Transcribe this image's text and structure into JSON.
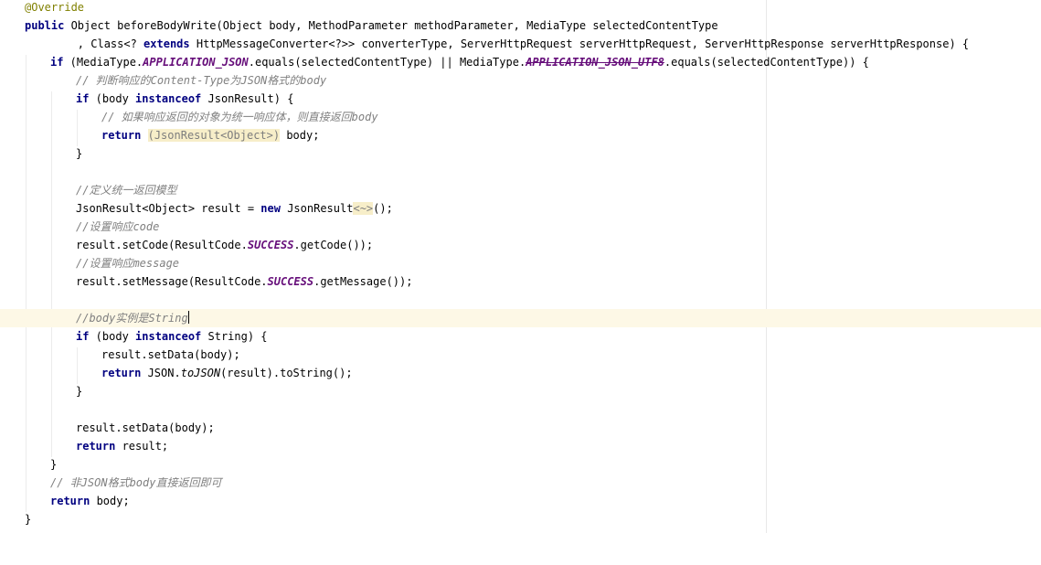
{
  "editor": {
    "lines": {
      "l1": "@Override",
      "l2_kw": "public",
      "l2_rest": " Object beforeBodyWrite(Object body, MethodParameter methodParameter, MediaType selectedContentType",
      "l3_a": "        , Class<? ",
      "l3_kw": "extends",
      "l3_b": " HttpMessageConverter<?>> converterType, ServerHttpRequest serverHttpRequest, ServerHttpResponse serverHttpResponse) {",
      "l4_kw": "if",
      "l4_a": " (MediaType.",
      "l4_c1": "APPLICATION_JSON",
      "l4_b": ".equals(selectedContentType) || MediaType.",
      "l4_c2": "APPLICATION_JSON_UTF8",
      "l4_c": ".equals(selectedContentType)) {",
      "l5": "// 判断响应的Content-Type为JSON格式的body",
      "l6_kw1": "if",
      "l6_a": " (body ",
      "l6_kw2": "instanceof",
      "l6_b": " JsonResult) {",
      "l7": "// 如果响应返回的对象为统一响应体，则直接返回body",
      "l8_kw": "return",
      "l8_fold": "(JsonResult<Object>)",
      "l8_b": " body;",
      "l9": "}",
      "l11": "//定义统一返回模型",
      "l12_a": "JsonResult<Object> result = ",
      "l12_kw": "new",
      "l12_b": " JsonResult",
      "l12_fold": "<~>",
      "l12_c": "();",
      "l13": "//设置响应code",
      "l14_a": "result.setCode(ResultCode.",
      "l14_c": "SUCCESS",
      "l14_b": ".getCode());",
      "l15": "//设置响应message",
      "l16_a": "result.setMessage(ResultCode.",
      "l16_c": "SUCCESS",
      "l16_b": ".getMessage());",
      "l18": "//body实例是String",
      "l19_kw1": "if",
      "l19_a": " (body ",
      "l19_kw2": "instanceof",
      "l19_b": " String) {",
      "l20": "result.setData(body);",
      "l21_kw": "return",
      "l21_a": " JSON.",
      "l21_s": "toJSON",
      "l21_b": "(result).toString();",
      "l22": "}",
      "l24": "result.setData(body);",
      "l25_kw": "return",
      "l25_b": " result;",
      "l26": "}",
      "l27": "// 非JSON格式body直接返回即可",
      "l28_kw": "return",
      "l28_b": " body;",
      "l29": "}"
    }
  }
}
